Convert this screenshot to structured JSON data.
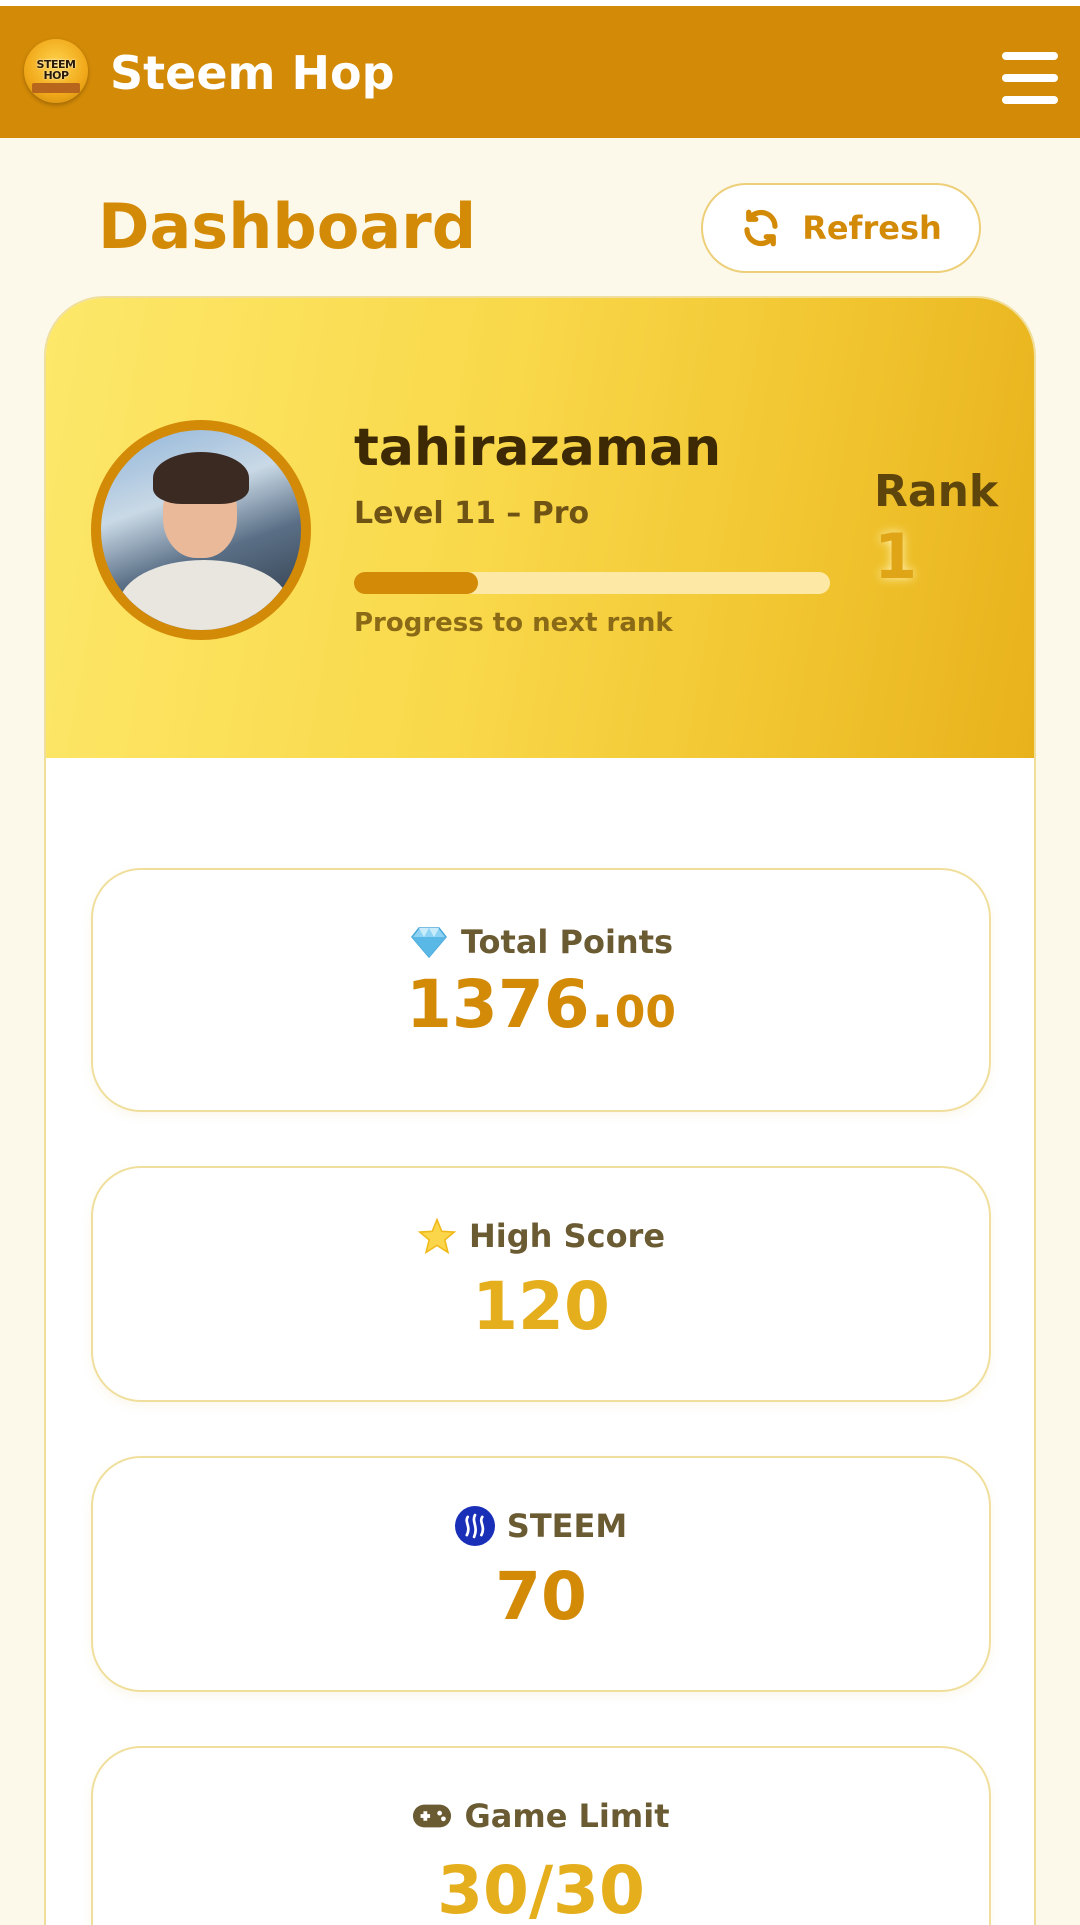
{
  "app": {
    "name": "Steem Hop",
    "logo_text": "STEEM HOP"
  },
  "header": {
    "title": "Dashboard",
    "refresh_label": "Refresh"
  },
  "profile": {
    "username": "tahirazaman",
    "level": "Level 11 – Pro",
    "progress_fraction": 0.26,
    "progress_label": "Progress to next rank",
    "rank_label": "Rank",
    "rank_value": "1"
  },
  "stats": {
    "total_points": {
      "title": "Total Points",
      "value_int": "1376.",
      "value_dec": "00",
      "icon": "diamond-icon"
    },
    "high_score": {
      "title": "High Score",
      "value": "120",
      "icon": "star-icon"
    },
    "steem": {
      "title": "STEEM",
      "value": "70",
      "icon": "steem-icon"
    },
    "game_limit": {
      "title": "Game Limit",
      "value": "30/30",
      "icon": "gamepad-icon"
    }
  },
  "colors": {
    "brand": "#d38a07",
    "accent_gold": "#e5ae1d",
    "background": "#fdf9ea"
  }
}
